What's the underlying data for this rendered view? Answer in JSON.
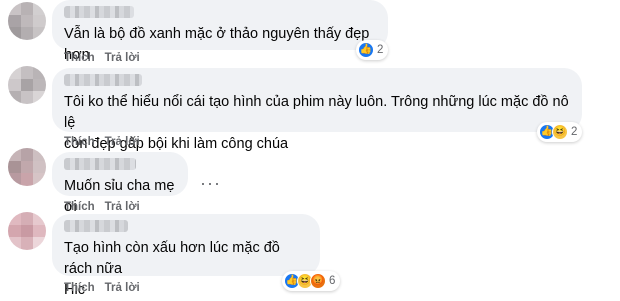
{
  "comments": [
    {
      "text": "Vẫn là bộ đồ xanh mặc ở thảo nguyên thấy đẹp hơn",
      "like_label": "Thích",
      "reply_label": "Trả lời",
      "reaction_count": "2"
    },
    {
      "text": "Tôi ko thể hiểu nổi cái tạo hình của phim này luôn. Trông những lúc mặc đồ nô lệ\ncòn đẹp gấp bội khi làm công chúa",
      "like_label": "Thích",
      "reply_label": "Trả lời",
      "reaction_count": "2"
    },
    {
      "text": "Muốn sỉu cha mẹ ơi",
      "like_label": "Thích",
      "reply_label": "Trả lời",
      "more_label": "···"
    },
    {
      "text": "Tạo hình còn xấu hơn lúc mặc đồ rách nữa\nHic",
      "like_label": "Thích",
      "reply_label": "Trả lời",
      "reaction_count": "6"
    }
  ],
  "icons": {
    "like": "like-reaction-icon",
    "haha": "haha-reaction-icon",
    "more": "more-options-icon"
  },
  "colors": {
    "bubble": "#f0f2f5",
    "like_blue": "#1877f2",
    "meta_gray": "#65676b"
  }
}
